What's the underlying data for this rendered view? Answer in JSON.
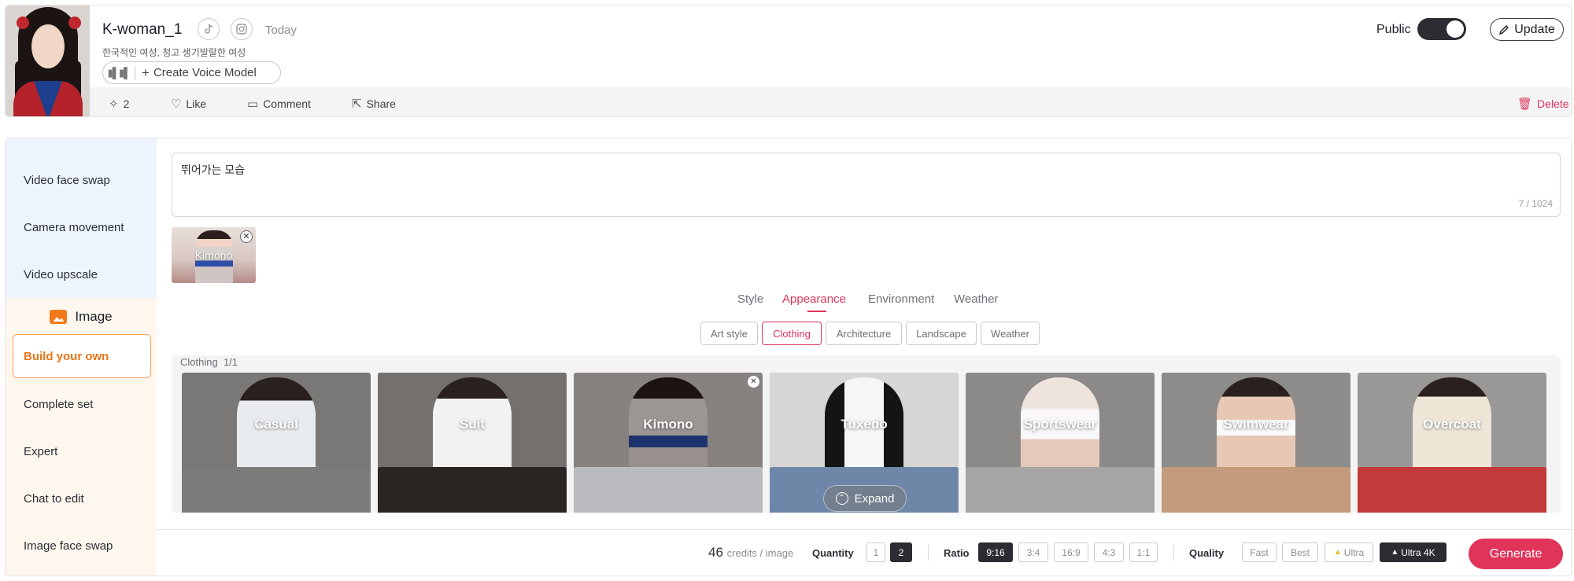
{
  "profile": {
    "name": "K-woman_1",
    "time": "Today",
    "description": "한국적인 여성, 청고 생기발랄한 여성",
    "voice_button": "Create Voice Model",
    "public_label": "Public",
    "public_on": true,
    "update_label": "Update"
  },
  "actions": {
    "likes_count": "2",
    "like": "Like",
    "comment": "Comment",
    "share": "Share",
    "delete": "Delete"
  },
  "sidebar": {
    "video_items": [
      "Video face swap",
      "Camera movement",
      "Video upscale"
    ],
    "section_title": "Image",
    "active_item": "Build your own",
    "image_items": [
      "Complete set",
      "Expert",
      "Chat to edit",
      "Image face swap"
    ]
  },
  "prompt": {
    "text": "뛰어가는 모습",
    "counter": "7 / 1024"
  },
  "selected_chip": "Kimono",
  "tabs": [
    "Style",
    "Appearance",
    "Environment",
    "Weather"
  ],
  "active_tab": "Appearance",
  "filters": [
    "Art style",
    "Clothing",
    "Architecture",
    "Landscape",
    "Weather"
  ],
  "active_filter": "Clothing",
  "grid": {
    "header": "Clothing",
    "count": "1/1",
    "tiles": [
      "Casual",
      "Suit",
      "Kimono",
      "Tuxedo",
      "Sportswear",
      "Swimwear",
      "Overcoat"
    ],
    "selected": "Kimono",
    "expand_label": "Expand"
  },
  "bottom": {
    "credits_value": "46",
    "credits_unit": "credits / image",
    "quantity_label": "Quantity",
    "quantity_options": [
      "1",
      "2"
    ],
    "quantity_selected": "2",
    "ratio_label": "Ratio",
    "ratio_options": [
      "9:16",
      "3:4",
      "16:9",
      "4:3",
      "1:1"
    ],
    "ratio_selected": "9:16",
    "quality_label": "Quality",
    "quality_options": [
      "Fast",
      "Best",
      "Ultra",
      "Ultra 4K"
    ],
    "quality_selected": "Ultra 4K",
    "generate_label": "Generate"
  },
  "colors": {
    "accent": "#e0345a",
    "orange": "#e87517",
    "dark": "#2b2d33"
  }
}
